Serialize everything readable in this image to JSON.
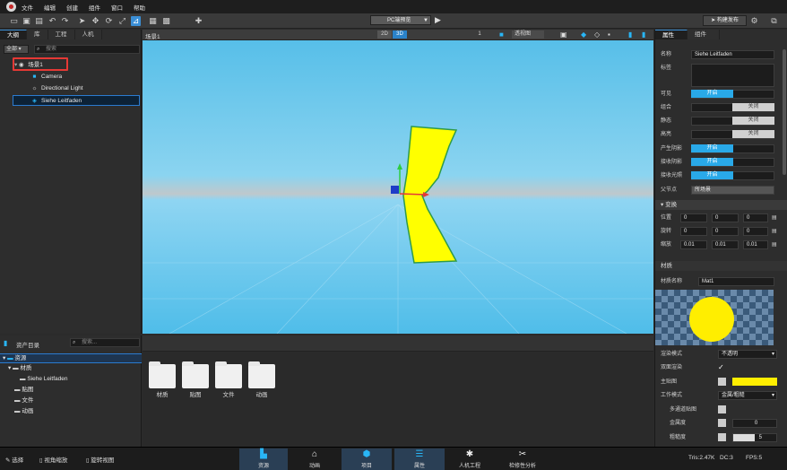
{
  "menu": {
    "items": [
      "文件",
      "编辑",
      "创建",
      "组件",
      "窗口",
      "帮助"
    ]
  },
  "toolbar": {
    "platform": "PC端预览",
    "publish_label": "构建发布"
  },
  "left_panel": {
    "tabs": [
      "大纲",
      "库",
      "工程",
      "人机"
    ],
    "filter": "全部",
    "search_placeholder": "搜索",
    "tree": [
      {
        "label": "场景1",
        "icon": "scene-icon"
      },
      {
        "label": "Camera",
        "icon": "camera-icon"
      },
      {
        "label": "Directional Light",
        "icon": "light-icon"
      },
      {
        "label": "Siehe Leitfaden",
        "icon": "mesh-icon"
      }
    ]
  },
  "viewport": {
    "tab": "场景1",
    "mode_2d": "2D",
    "mode_3d": "3D",
    "count": "1",
    "view": "透视图"
  },
  "assets_panel": {
    "title": "资产目录",
    "search_placeholder": "搜索...",
    "tree": [
      {
        "label": "资源"
      },
      {
        "label": "材质"
      },
      {
        "label": "Siehe Leitfaden"
      },
      {
        "label": "贴图"
      },
      {
        "label": "文件"
      },
      {
        "label": "动画"
      }
    ],
    "folders": [
      "材质",
      "贴图",
      "文件",
      "动画"
    ]
  },
  "right_panel": {
    "tabs": [
      "属性",
      "组件"
    ],
    "name_label": "名称",
    "name_value": "Siehe Leitfaden",
    "tag_label": "标签",
    "toggles": [
      {
        "label": "可见",
        "value": "开启",
        "on": true
      },
      {
        "label": "组合",
        "value": "关闭",
        "on": false
      },
      {
        "label": "静态",
        "value": "关闭",
        "on": false
      },
      {
        "label": "高亮",
        "value": "关闭",
        "on": false
      },
      {
        "label": "产生阴影",
        "value": "开启",
        "on": true
      },
      {
        "label": "接收阴影",
        "value": "开启",
        "on": true
      },
      {
        "label": "接收光照",
        "value": "开启",
        "on": true
      }
    ],
    "parent_label": "父节点",
    "parent_value": "所场景",
    "transform_title": "变换",
    "transform": [
      {
        "label": "位置",
        "x": "0",
        "y": "0",
        "z": "0"
      },
      {
        "label": "旋转",
        "x": "0",
        "y": "0",
        "z": "0"
      },
      {
        "label": "缩放",
        "x": "0.01",
        "y": "0.01",
        "z": "0.01"
      }
    ],
    "material_title": "材质",
    "material_name_label": "材质名称",
    "material_name": "Mat1",
    "material_color": "#ffee00",
    "mat_props": [
      {
        "label": "渲染模式",
        "value": "不透明"
      },
      {
        "label": "双面渲染",
        "value": "✓"
      },
      {
        "label": "主贴图",
        "value": ""
      },
      {
        "label": "工作模式",
        "value": "金属/粗糙"
      },
      {
        "label": "多通道贴图",
        "value": ""
      },
      {
        "label": "金属度",
        "value": "0"
      },
      {
        "label": "粗糙度",
        "value": "5"
      }
    ]
  },
  "statusbar": {
    "left": [
      "选择",
      "视角缩放",
      "旋转视图"
    ],
    "buttons": [
      "资源",
      "动画",
      "项目",
      "属性",
      "人机工程",
      "检修性分析"
    ],
    "tris": "Tris:2.47K",
    "dc": "DC:3",
    "fps": "FPS:5"
  },
  "colors": {
    "accent": "#29a9e8",
    "highlight_border": "#e53935",
    "object": "#ffee00"
  }
}
